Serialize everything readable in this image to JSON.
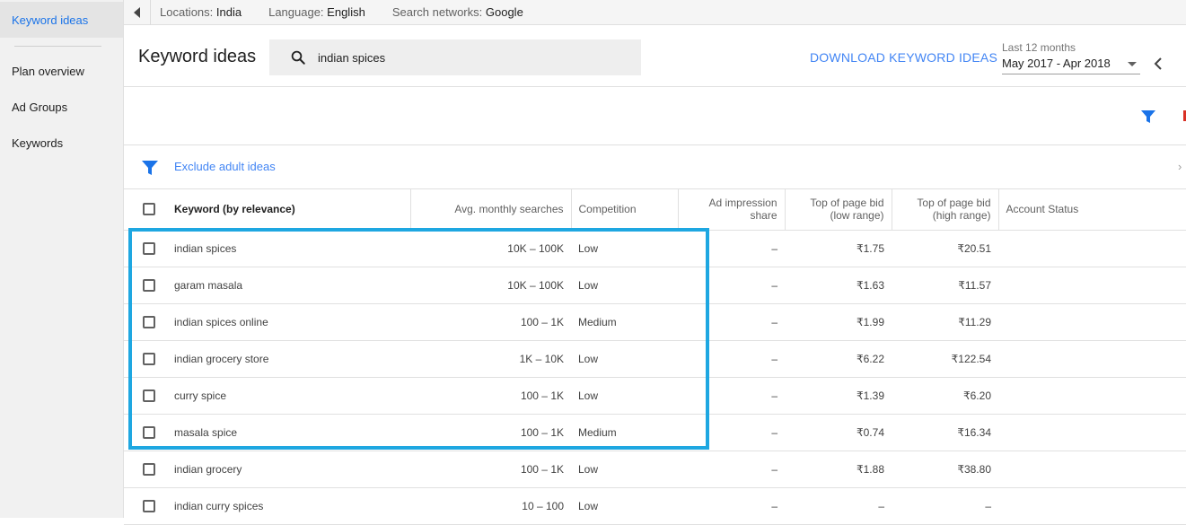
{
  "sidebar": {
    "items": [
      {
        "label": "Keyword ideas",
        "active": true
      },
      {
        "label": "Plan overview",
        "active": false
      },
      {
        "label": "Ad Groups",
        "active": false
      },
      {
        "label": "Keywords",
        "active": false
      }
    ]
  },
  "topbar": {
    "locations_label": "Locations:",
    "locations_value": "India",
    "language_label": "Language:",
    "language_value": "English",
    "networks_label": "Search networks:",
    "networks_value": "Google"
  },
  "header": {
    "title": "Keyword ideas",
    "search_value": "indian spices",
    "download_label": "DOWNLOAD KEYWORD IDEAS",
    "date_label": "Last 12 months",
    "date_range": "May 2017 - Apr 2018"
  },
  "filter": {
    "exclude_label": "Exclude adult ideas"
  },
  "colors": {
    "accent": "#4285f4",
    "highlight_border": "#1ea7e1",
    "filter_icon": "#1a73e8"
  },
  "table": {
    "headers": {
      "keyword": "Keyword (by relevance)",
      "searches": "Avg. monthly searches",
      "competition": "Competition",
      "impression_l1": "Ad impression",
      "impression_l2": "share",
      "bid_low_l1": "Top of page bid",
      "bid_low_l2": "(low range)",
      "bid_high_l1": "Top of page bid",
      "bid_high_l2": "(high range)",
      "account": "Account Status"
    },
    "rows": [
      {
        "keyword": "indian spices",
        "searches": "10K – 100K",
        "competition": "Low",
        "impression": "–",
        "bid_low": "₹1.75",
        "bid_high": "₹20.51"
      },
      {
        "keyword": "garam masala",
        "searches": "10K – 100K",
        "competition": "Low",
        "impression": "–",
        "bid_low": "₹1.63",
        "bid_high": "₹11.57"
      },
      {
        "keyword": "indian spices online",
        "searches": "100 – 1K",
        "competition": "Medium",
        "impression": "–",
        "bid_low": "₹1.99",
        "bid_high": "₹11.29"
      },
      {
        "keyword": "indian grocery store",
        "searches": "1K – 10K",
        "competition": "Low",
        "impression": "–",
        "bid_low": "₹6.22",
        "bid_high": "₹122.54"
      },
      {
        "keyword": "curry spice",
        "searches": "100 – 1K",
        "competition": "Low",
        "impression": "–",
        "bid_low": "₹1.39",
        "bid_high": "₹6.20"
      },
      {
        "keyword": "masala spice",
        "searches": "100 – 1K",
        "competition": "Medium",
        "impression": "–",
        "bid_low": "₹0.74",
        "bid_high": "₹16.34"
      },
      {
        "keyword": "indian grocery",
        "searches": "100 – 1K",
        "competition": "Low",
        "impression": "–",
        "bid_low": "₹1.88",
        "bid_high": "₹38.80"
      },
      {
        "keyword": "indian curry spices",
        "searches": "10 – 100",
        "competition": "Low",
        "impression": "–",
        "bid_low": "–",
        "bid_high": "–"
      }
    ]
  }
}
